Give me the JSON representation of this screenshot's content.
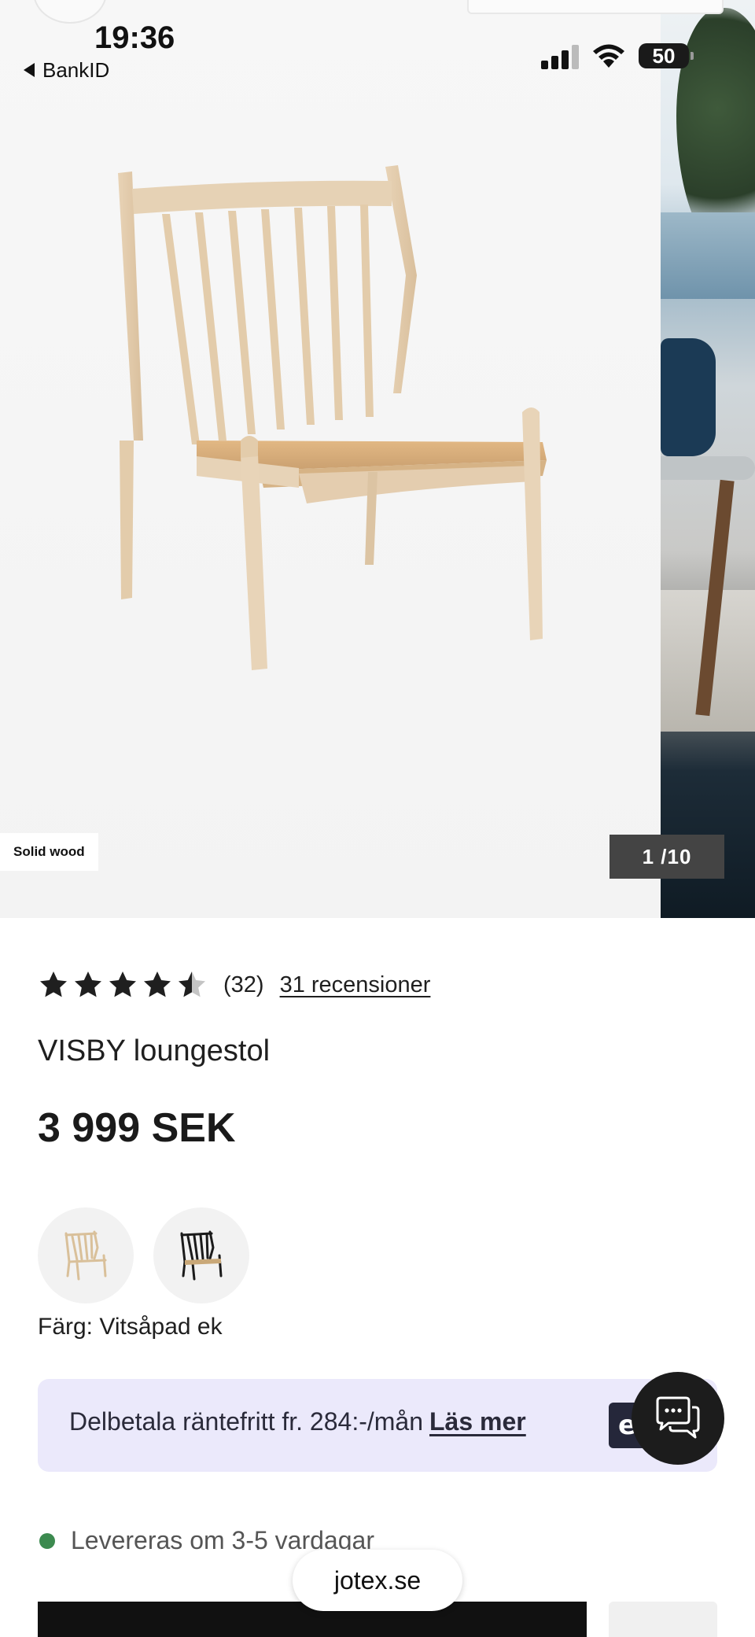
{
  "status_bar": {
    "time": "19:36",
    "back_app": "BankID",
    "battery": "50"
  },
  "gallery": {
    "material_tag": "Solid wood",
    "counter": "1 /10"
  },
  "product": {
    "rating_value": 4.5,
    "rating_count": "(32)",
    "reviews_link": "31 recensioner",
    "title": "VISBY loungestol",
    "price": "3 999 SEK",
    "color_label": "Färg: Vitsåpad ek",
    "swatches": [
      {
        "name": "Vitsåpad ek",
        "color": "#e7d4b8"
      },
      {
        "name": "black",
        "color": "#1b1b1b"
      }
    ]
  },
  "finance": {
    "text": "Delbetala räntefritt fr. 284:-/mån",
    "link": "Läs mer",
    "logo_letter": "e"
  },
  "delivery": {
    "text": "Levereras om 3-5 vardagar",
    "status_color": "#3c8a4f"
  },
  "browser": {
    "url": "jotex.se"
  },
  "icons": {
    "chat": "chat-bubble-icon",
    "back": "back-triangle-icon",
    "star": "star-icon"
  }
}
